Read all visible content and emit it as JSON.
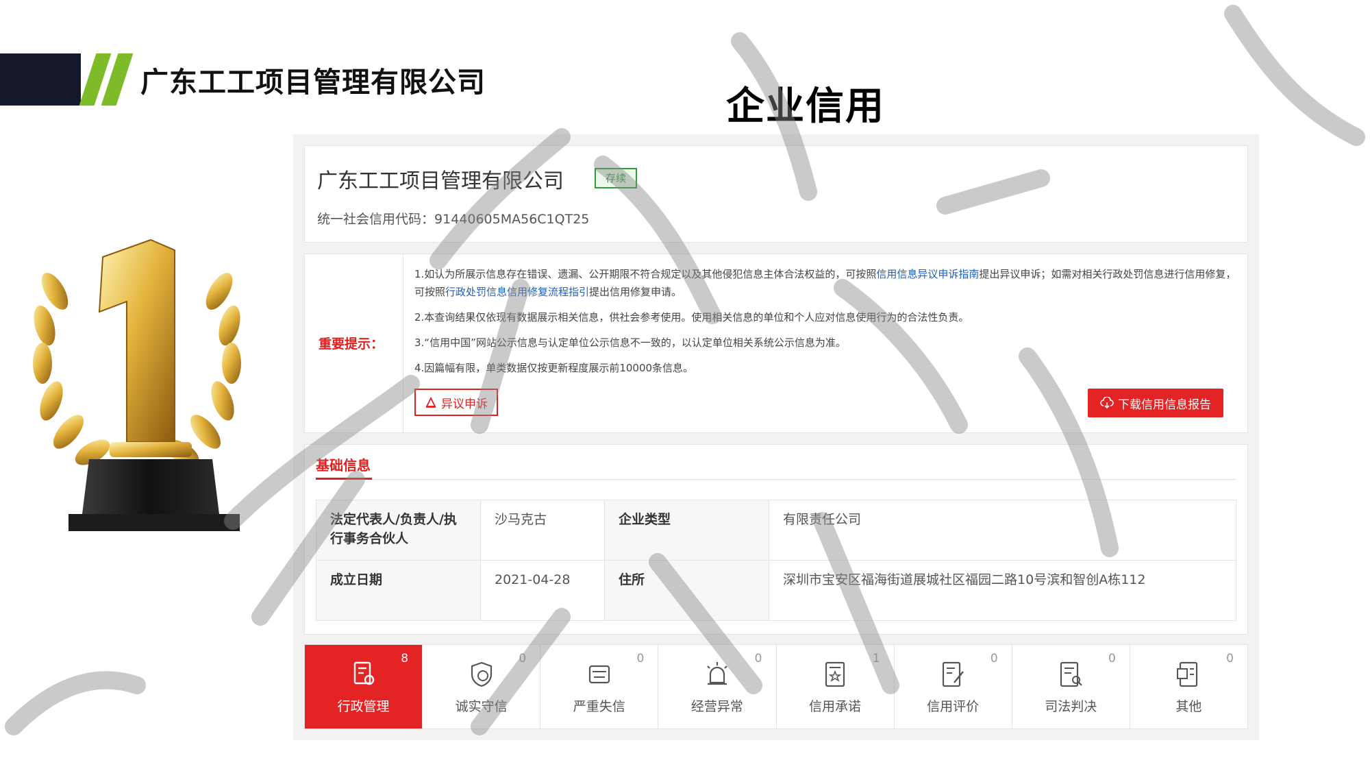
{
  "header": {
    "company_name": "广东工工项目管理有限公司",
    "page_title": "企业信用"
  },
  "company": {
    "name": "广东工工项目管理有限公司",
    "status": "存续",
    "credit_code_label": "统一社会信用代码：",
    "credit_code": "91440605MA56C1QT25"
  },
  "notice": {
    "label": "重要提示：",
    "line1_a": "1.如认为所展示信息存在错误、遗漏、公开期限不符合规定以及其他侵犯信息主体合法权益的，可按照",
    "line1_link1": "信用信息异议申诉指南",
    "line1_b": "提出异议申诉；如需对相关行政处罚信息进行信用修复，可按照",
    "line1_link2": "行政处罚信息信用修复流程指引",
    "line1_c": "提出信用修复申请。",
    "line2": "2.本查询结果仅依现有数据展示相关信息，供社会参考使用。使用相关信息的单位和个人应对信息使用行为的合法性负责。",
    "line3": "3.“信用中国”网站公示信息与认定单位公示信息不一致的，以认定单位相关系统公示信息为准。",
    "line4": "4.因篇幅有限，单类数据仅按更新程度展示前10000条信息。",
    "appeal_button": "异议申诉",
    "download_button": "下载信用信息报告"
  },
  "basic_info": {
    "section_title": "基础信息",
    "rows": [
      {
        "k1": "法定代表人/负责人/执行事务合伙人",
        "v1": "沙马克古",
        "k2": "企业类型",
        "v2": "有限责任公司"
      },
      {
        "k1": "成立日期",
        "v1": "2021-04-28",
        "k2": "住所",
        "v2": "深圳市宝安区福海街道展城社区福园二路10号滨和智创A栋112"
      }
    ]
  },
  "tabs": [
    {
      "label": "行政管理",
      "count": "8",
      "icon": "admin-doc-icon",
      "active": true
    },
    {
      "label": "诚实守信",
      "count": "0",
      "icon": "shield-credit-icon"
    },
    {
      "label": "严重失信",
      "count": "0",
      "icon": "dishonest-icon"
    },
    {
      "label": "经营异常",
      "count": "0",
      "icon": "alarm-icon"
    },
    {
      "label": "信用承诺",
      "count": "1",
      "icon": "promise-doc-icon"
    },
    {
      "label": "信用评价",
      "count": "0",
      "icon": "evaluation-icon"
    },
    {
      "label": "司法判决",
      "count": "0",
      "icon": "judgment-icon"
    },
    {
      "label": "其他",
      "count": "0",
      "icon": "other-doc-icon"
    }
  ],
  "colors": {
    "accent_red": "#e42424",
    "brand_green": "#7dbb28",
    "brand_dark": "#15172b"
  }
}
